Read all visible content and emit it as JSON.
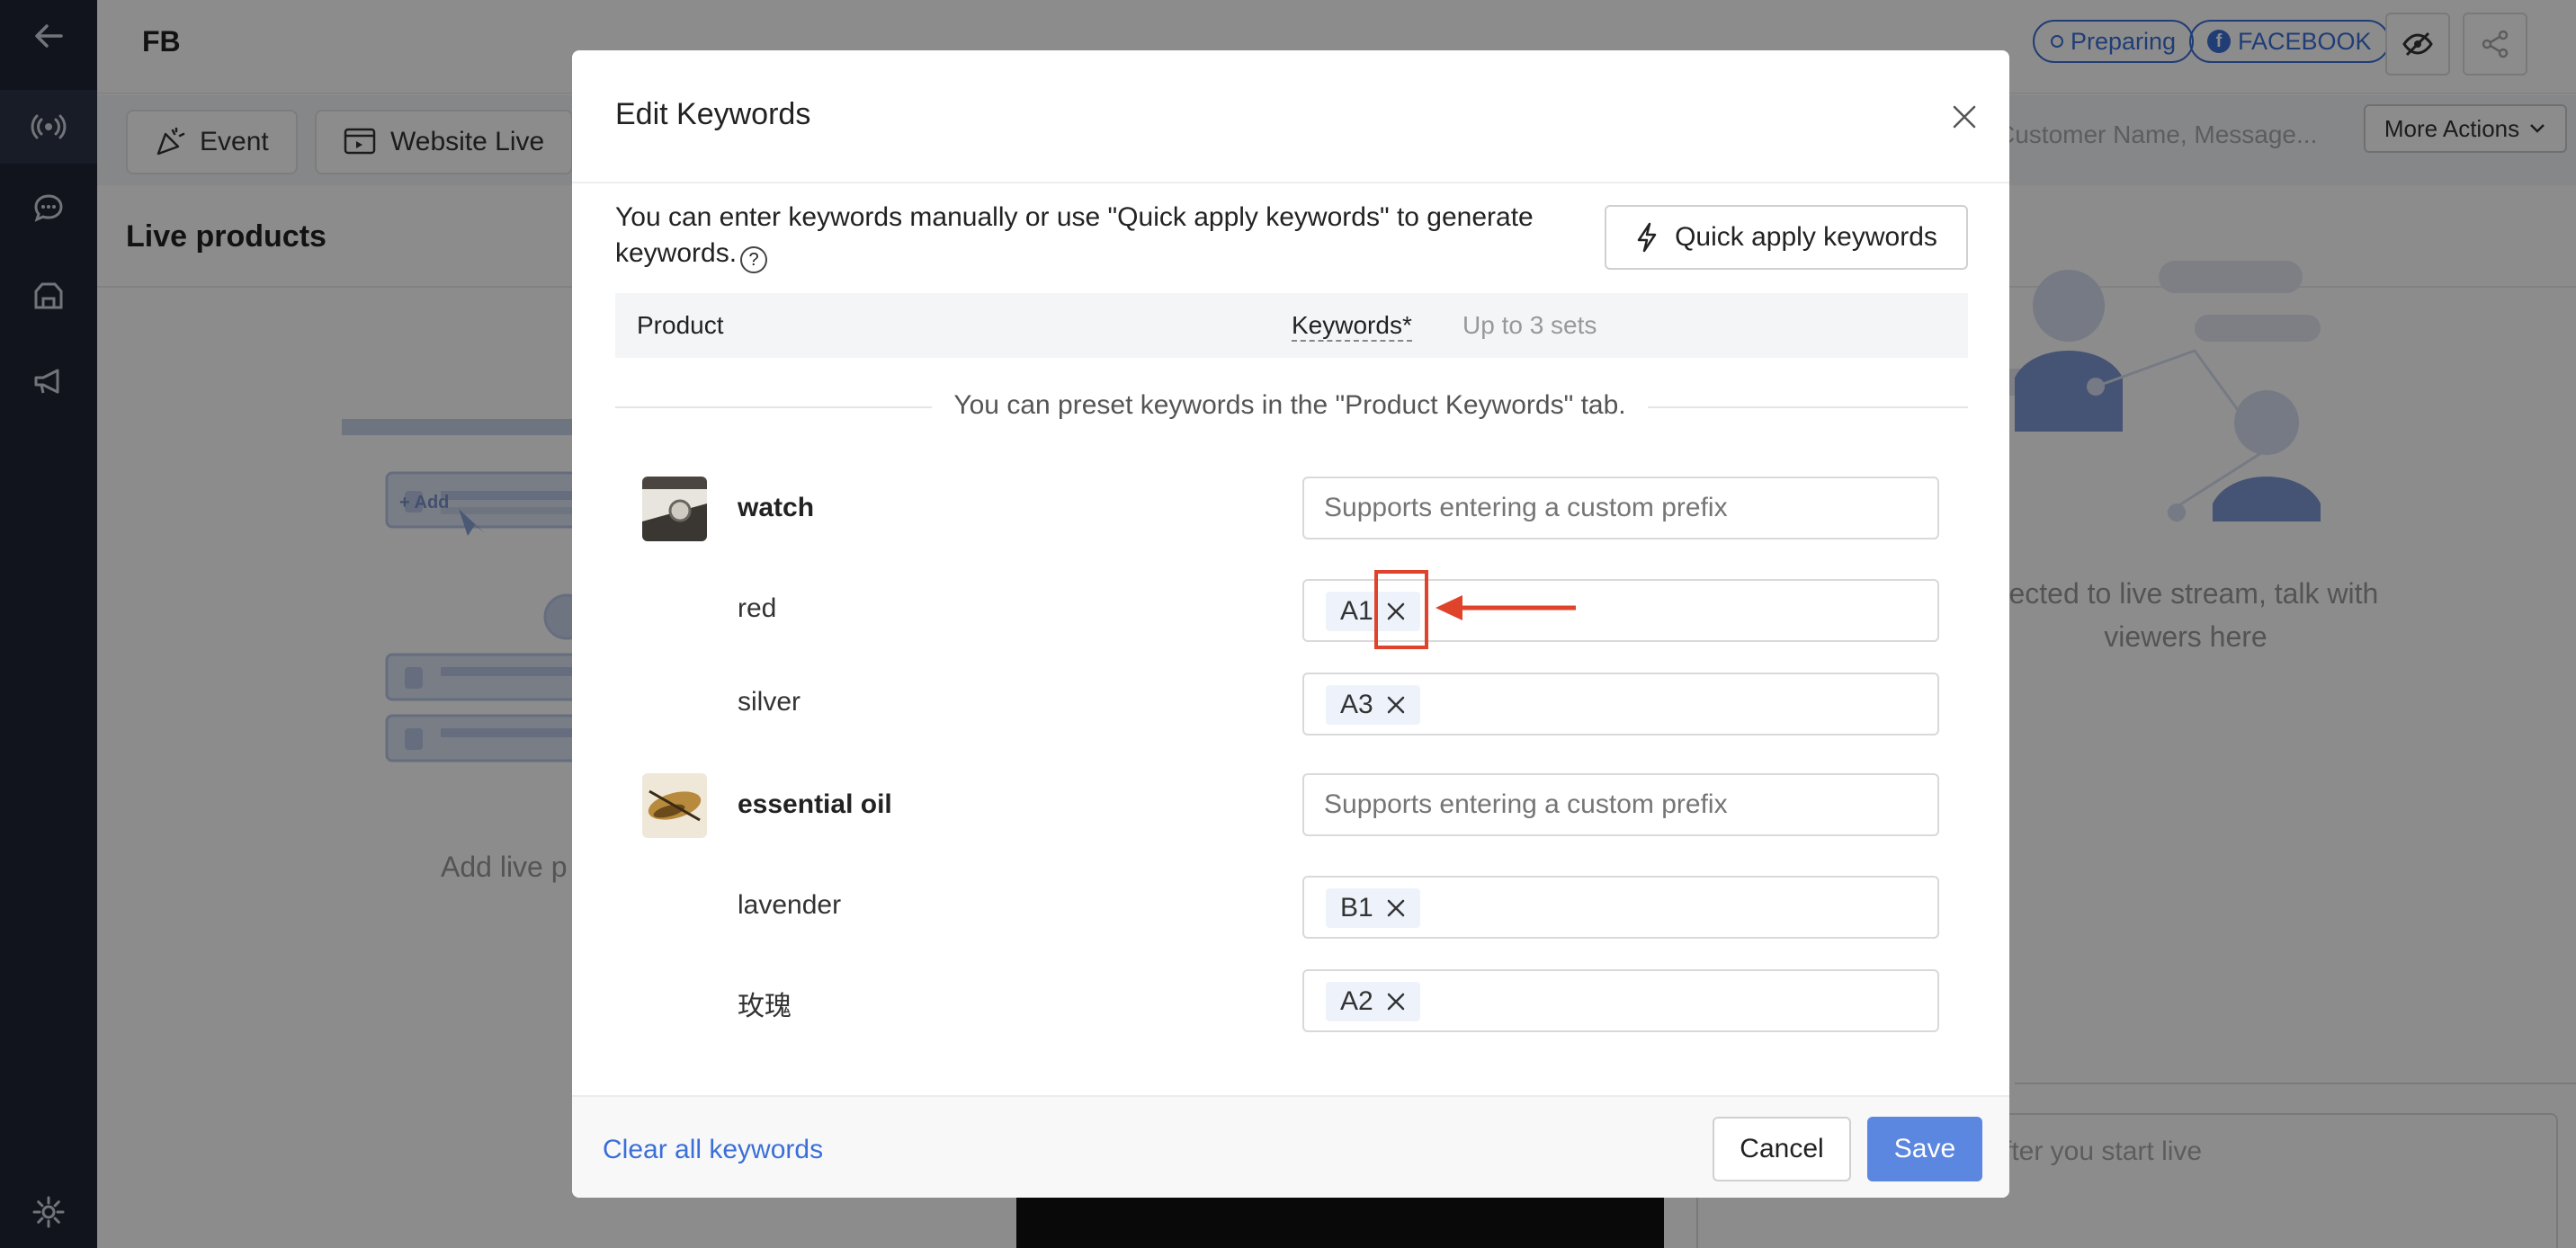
{
  "app": {
    "title": "FB",
    "status_pill": "Preparing",
    "platform_pill": "FACEBOOK",
    "tabs": [
      {
        "label": "Event"
      },
      {
        "label": "Website Live"
      }
    ],
    "search_placeholder": "Customer Name, Message...",
    "more_actions_label": "More Actions",
    "live_products_title": "Live products",
    "add_live_text": "Add live p",
    "connected_text": "nected to live stream, talk with viewers here",
    "chat_input_placeholder": "fter you start live",
    "illus_add_label": "+ Add"
  },
  "modal": {
    "title": "Edit Keywords",
    "intro": "You can enter keywords manually or use \"Quick apply keywords\" to generate keywords.",
    "quick_apply_label": "Quick apply keywords",
    "table_header": {
      "product": "Product",
      "keywords": "Keywords*",
      "keywords_hint": "Up to 3 sets"
    },
    "preset_hint": "You can preset keywords in the \"Product Keywords\" tab.",
    "custom_prefix_placeholder": "Supports entering a custom prefix",
    "products": [
      {
        "name": "watch",
        "variants": [
          {
            "name": "red",
            "keyword": "A1"
          },
          {
            "name": "silver",
            "keyword": "A3"
          }
        ]
      },
      {
        "name": "essential oil",
        "variants": [
          {
            "name": "lavender",
            "keyword": "B1"
          },
          {
            "name": "玫瑰",
            "keyword": "A2"
          }
        ]
      }
    ],
    "footer": {
      "clear_label": "Clear all keywords",
      "cancel_label": "Cancel",
      "save_label": "Save"
    }
  },
  "colors": {
    "accent": "#3b6fd8",
    "primary_button": "#5b87e0",
    "annotation": "#e0432b",
    "sidebar": "#1f2535"
  }
}
